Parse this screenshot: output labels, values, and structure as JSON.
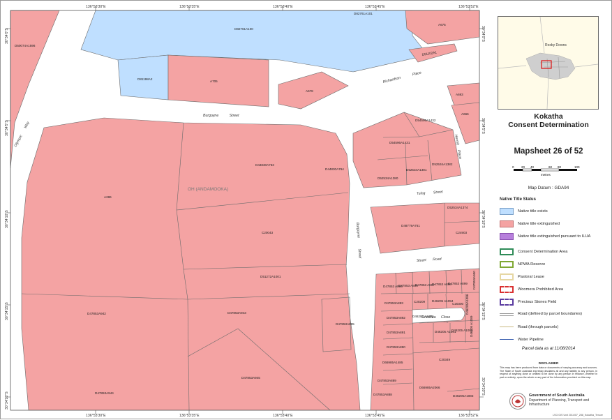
{
  "map": {
    "coords": {
      "top": [
        "136°53'30\"E",
        "136°53'35\"E",
        "136°53'40\"E",
        "136°53'45\"E",
        "136°53'52\"E"
      ],
      "bottom": [
        "136°53'30\"E",
        "136°53'35\"E",
        "136°53'40\"E",
        "136°53'45\"E",
        "136°53'52\"E"
      ],
      "left": [
        "30°34'0\"S",
        "30°34'5\"S",
        "30°34'10\"S",
        "30°34'15\"S",
        "30°34'20\"S",
        "30°34'25\"S"
      ],
      "right": [
        "30°34'0\"S",
        "30°34'5\"S",
        "30°34'10\"S",
        "30°34'15\"S",
        "30°34'20\"S",
        "30°34'25\"S"
      ]
    },
    "streets": {
      "burgoyne": "Burgoyne",
      "burgoyne_suffix": "Street",
      "olympic": "Olympic",
      "olympic_suffix": "Way",
      "richardson": "Richardson",
      "richardson_suffix": "Place",
      "hermit": "Hermit",
      "hermit_suffix": "Place",
      "tulog": "Tulog",
      "tulog_suffix": "Street",
      "burgoyne2": "Burgoyne",
      "burgoyne2_suffix": "Street",
      "stuart": "Stuart",
      "stuart_suffix": "Road",
      "grevillea": "Grevillea",
      "grevillea_suffix": "Close"
    },
    "area_label": "OH (ANDAMOOKA)",
    "parcels": {
      "d50074": "D50074A1596",
      "d82761": "D82761A100",
      "d82761b": "D82761A101",
      "a675": "A675",
      "d81198": "D81198A2",
      "a705": "A705",
      "d51102": "D51102A1",
      "a678": "A678",
      "a693": "A693",
      "a666": "A666",
      "d54596a": "D54596A1432",
      "d54596b": "D54596A1431",
      "d52534a": "D52534A1381",
      "d52534b": "D52534A1382",
      "d52534c": "D52534A1380",
      "d44830": "D44830A763",
      "d44830b": "D44830A764",
      "a286": "A286",
      "c20043": "C20043",
      "d52534d": "D52534A1374",
      "d48779": "D48779A761",
      "c24903": "C24903",
      "d51272": "D51272A1001",
      "d47853_942": "D47853A942",
      "d47853_943": "D47853A943",
      "d47853_895": "D47853A895",
      "d47853_944": "D47853A944",
      "d47853_945": "D47853A945",
      "g_a894": "D47853 A894",
      "g_a896": "D47853 A896",
      "g_a897": "D47853 A897",
      "g_a898": "D47853 A898",
      "g_a899": "D47853 A899",
      "g_a900": "D47853A900",
      "g_a893": "D47853A893",
      "c20209": "C20209",
      "c20300": "C20300",
      "g_a892": "D47853A892",
      "d46205_1092": "D46205 A1092",
      "d46205_1094": "D46205 A1094",
      "d46205_1086": "D46205A1086",
      "g_a891": "D47853A891",
      "d46205_1091": "D46205 A1091",
      "d46205_1090": "D46205 A1090",
      "d46205_1089": "D46205 A1089",
      "g_a890": "D47853A890",
      "c20349": "C20349",
      "d66985_1485": "D66985A1485",
      "g_a889": "D47853A889",
      "d66985_2066": "D66985A2066",
      "g_a888": "D47853A888",
      "d46205_1083": "D46205A1083"
    }
  },
  "panel": {
    "inset_label": "Roxby Downs",
    "title_line1": "Kokatha",
    "title_line2": "Consent Determination",
    "mapsheet": "Mapsheet 26 of 52",
    "scale_ticks": [
      "0",
      "20",
      "40",
      "60",
      "80",
      "100"
    ],
    "scale_unit": "metres",
    "datum": "Map Datum : GDA94",
    "legend_title": "Native Title Status",
    "legend": [
      {
        "label": "Native title exists",
        "fill": "#bfdfff",
        "border": "#7aa0c8"
      },
      {
        "label": "Native title extinguished",
        "fill": "#f4a3a3",
        "border": "#c07070"
      },
      {
        "label": "Native title extinguished pursuant to ILUA",
        "fill": "#b77fdc",
        "border": "#8a50b0"
      },
      {
        "label": "Consent Determination Area",
        "fill": "#ffffff",
        "border": "#2e8b57"
      },
      {
        "label": "NPWA Reserve",
        "fill": "#ffffff",
        "border": "#7fa832"
      },
      {
        "label": "Pastoral Lease",
        "fill": "#ffffff",
        "border": "#e6d7a3"
      },
      {
        "label": "Woomera Prohibited Area",
        "fill": "#ffffff",
        "border": "#d93030"
      },
      {
        "label": "Precious Stones Field",
        "fill": "#ffffff",
        "border": "#5a3aa0"
      },
      {
        "label": "Road (defined by parcel boundaries)",
        "fill": "#ffffff",
        "border": "#999999"
      },
      {
        "label": "Road (through parcels)",
        "fill": "#ffffff",
        "border": "#c9b980"
      },
      {
        "label": "Water Pipeline",
        "fill": "#ffffff",
        "border": "#3a5fb0"
      }
    ],
    "parcel_date": "Parcel data as at 11/08/2014",
    "disclaimer_title": "DISCLAIMER",
    "disclaimer": "This map has been produced from data or documents of varying accuracy and sources. The State of South Australia expressly disclaims all and any liability to any person, in respect of anything done or omitted to be done by any person in reliance, whether in part or entirely, upon the whole or any part of the information provided on this map.",
    "gov_line1": "Government of South Australia",
    "gov_line2": "Department of Planning, Transport and Infrastructure",
    "ref": "LSG GIS Unit 2014/07_288_Kokatha_Tenure"
  }
}
